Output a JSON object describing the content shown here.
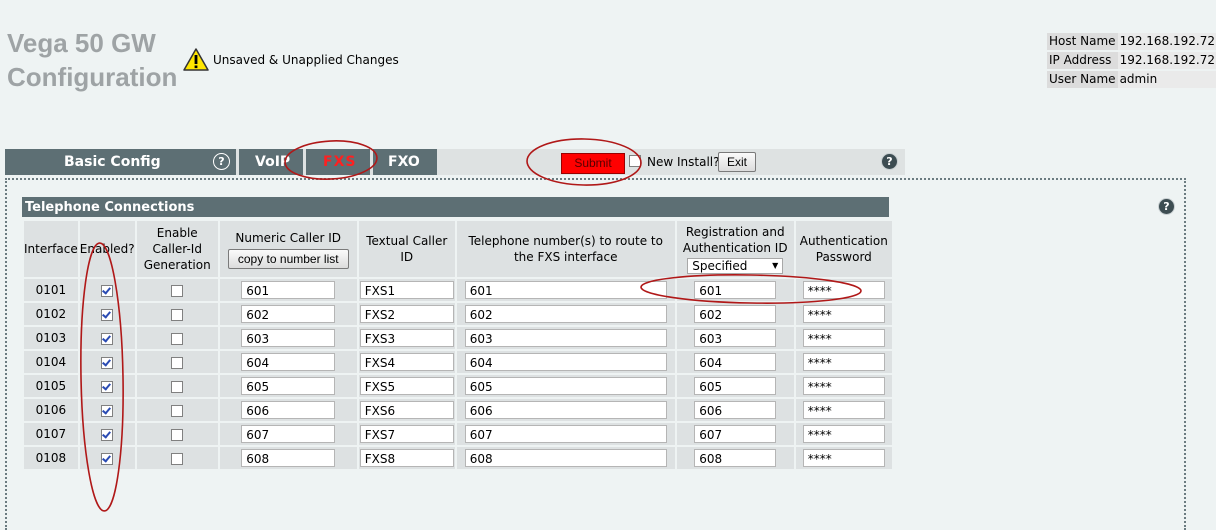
{
  "header": {
    "title": "Vega 50 GW Configuration",
    "warning": "Unsaved & Unapplied Changes"
  },
  "info": [
    {
      "key": "Host Name",
      "value": "192.168.192.72"
    },
    {
      "key": "IP Address",
      "value": "192.168.192.72"
    },
    {
      "key": "User Name",
      "value": "admin"
    }
  ],
  "menu": {
    "basic_config": "Basic Config",
    "voip": "VoIP",
    "fxs": "FXS",
    "fxo": "FXO",
    "submit": "Submit",
    "new_install": "New Install?",
    "exit": "Exit",
    "help": "?"
  },
  "section": {
    "title": "Telephone Connections",
    "columns": {
      "interface": "Interface",
      "enabled": "Enabled?",
      "enable_cid": "Enable Caller-Id Generation",
      "numeric_cid": "Numeric Caller ID",
      "copy_button": "copy to number list",
      "textual_cid": "Textual Caller ID",
      "route": "Telephone number(s) to route to the FXS interface",
      "reg_auth": "Registration and Authentication ID",
      "reg_auth_select": "Specified",
      "auth_pw": "Authentication Password"
    },
    "rows": [
      {
        "interface": "0101",
        "enabled": true,
        "cid_gen": false,
        "numeric": "601",
        "textual": "FXS1",
        "route": "601",
        "reg": "601",
        "password": "****"
      },
      {
        "interface": "0102",
        "enabled": true,
        "cid_gen": false,
        "numeric": "602",
        "textual": "FXS2",
        "route": "602",
        "reg": "602",
        "password": "****"
      },
      {
        "interface": "0103",
        "enabled": true,
        "cid_gen": false,
        "numeric": "603",
        "textual": "FXS3",
        "route": "603",
        "reg": "603",
        "password": "****"
      },
      {
        "interface": "0104",
        "enabled": true,
        "cid_gen": false,
        "numeric": "604",
        "textual": "FXS4",
        "route": "604",
        "reg": "604",
        "password": "****"
      },
      {
        "interface": "0105",
        "enabled": true,
        "cid_gen": false,
        "numeric": "605",
        "textual": "FXS5",
        "route": "605",
        "reg": "605",
        "password": "****"
      },
      {
        "interface": "0106",
        "enabled": true,
        "cid_gen": false,
        "numeric": "606",
        "textual": "FXS6",
        "route": "606",
        "reg": "606",
        "password": "****"
      },
      {
        "interface": "0107",
        "enabled": true,
        "cid_gen": false,
        "numeric": "607",
        "textual": "FXS7",
        "route": "607",
        "reg": "607",
        "password": "****"
      },
      {
        "interface": "0108",
        "enabled": true,
        "cid_gen": false,
        "numeric": "608",
        "textual": "FXS8",
        "route": "608",
        "reg": "608",
        "password": "****"
      }
    ]
  },
  "colors": {
    "tab_bg": "#5d6f74",
    "submit": "#ff0000",
    "annotation": "#b01818",
    "fxs_label": "#ff2020"
  }
}
